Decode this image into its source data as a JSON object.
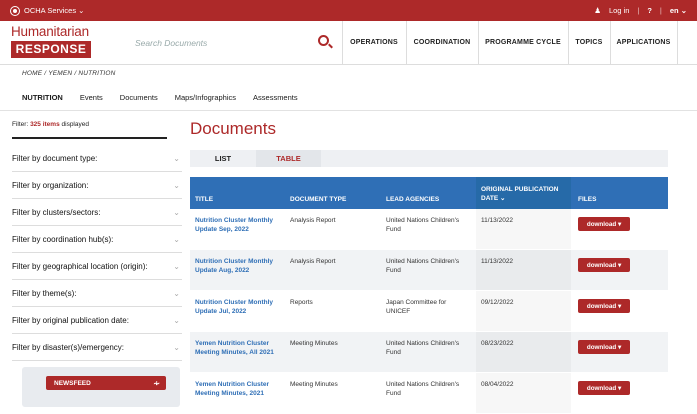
{
  "topbar": {
    "ocha_services": "OCHA Services ⌄",
    "login": "Log in",
    "help": "?",
    "lang": "en ⌄"
  },
  "header": {
    "logo_line1": "Humanitarian",
    "logo_line2": "RESPONSE",
    "search_placeholder": "Search Documents",
    "nav": [
      "OPERATIONS",
      "COORDINATION",
      "PROGRAMME CYCLE",
      "TOPICS",
      "APPLICATIONS"
    ]
  },
  "breadcrumb": "HOME / YEMEN / NUTRITION",
  "tabs": [
    "NUTRITION",
    "Events",
    "Documents",
    "Maps/Infographics",
    "Assessments"
  ],
  "sidebar": {
    "filter_prefix": "Filter: ",
    "filter_count": "325 items",
    "filter_suffix": " displayed",
    "filters": [
      "Filter by document type:",
      "Filter by organization:",
      "Filter by clusters/sectors:",
      "Filter by coordination hub(s):",
      "Filter by geographical location (origin):",
      "Filter by theme(s):",
      "Filter by original publication date:",
      "Filter by disaster(s)/emergency:"
    ],
    "newsfeed": "NEWSFEED"
  },
  "main": {
    "title": "Documents",
    "view_list": "LIST",
    "view_table": "TABLE",
    "columns": {
      "title": "TITLE",
      "type": "DOCUMENT TYPE",
      "lead": "LEAD AGENCIES",
      "date": "ORIGINAL PUBLICATION DATE ⌄",
      "files": "FILES"
    },
    "download": "download ▾",
    "rows": [
      {
        "title": "Nutrition Cluster Monthly Update Sep, 2022",
        "type": "Analysis Report",
        "lead": "United Nations Children's Fund",
        "date": "11/13/2022"
      },
      {
        "title": "Nutrition Cluster Monthly Update Aug, 2022",
        "type": "Analysis Report",
        "lead": "United Nations Children's Fund",
        "date": "11/13/2022"
      },
      {
        "title": "Nutrition Cluster Monthly Update Jul, 2022",
        "type": "Reports",
        "lead": "Japan Committee for UNICEF",
        "date": "09/12/2022"
      },
      {
        "title": "Yemen Nutrition Cluster Meeting Minutes, All 2021",
        "type": "Meeting Minutes",
        "lead": "United Nations Children's Fund",
        "date": "08/23/2022"
      },
      {
        "title": "Yemen Nutrition Cluster Meeting Minutes, 2021",
        "type": "Meeting Minutes",
        "lead": "United Nations Children's Fund",
        "date": "08/04/2022"
      }
    ]
  }
}
